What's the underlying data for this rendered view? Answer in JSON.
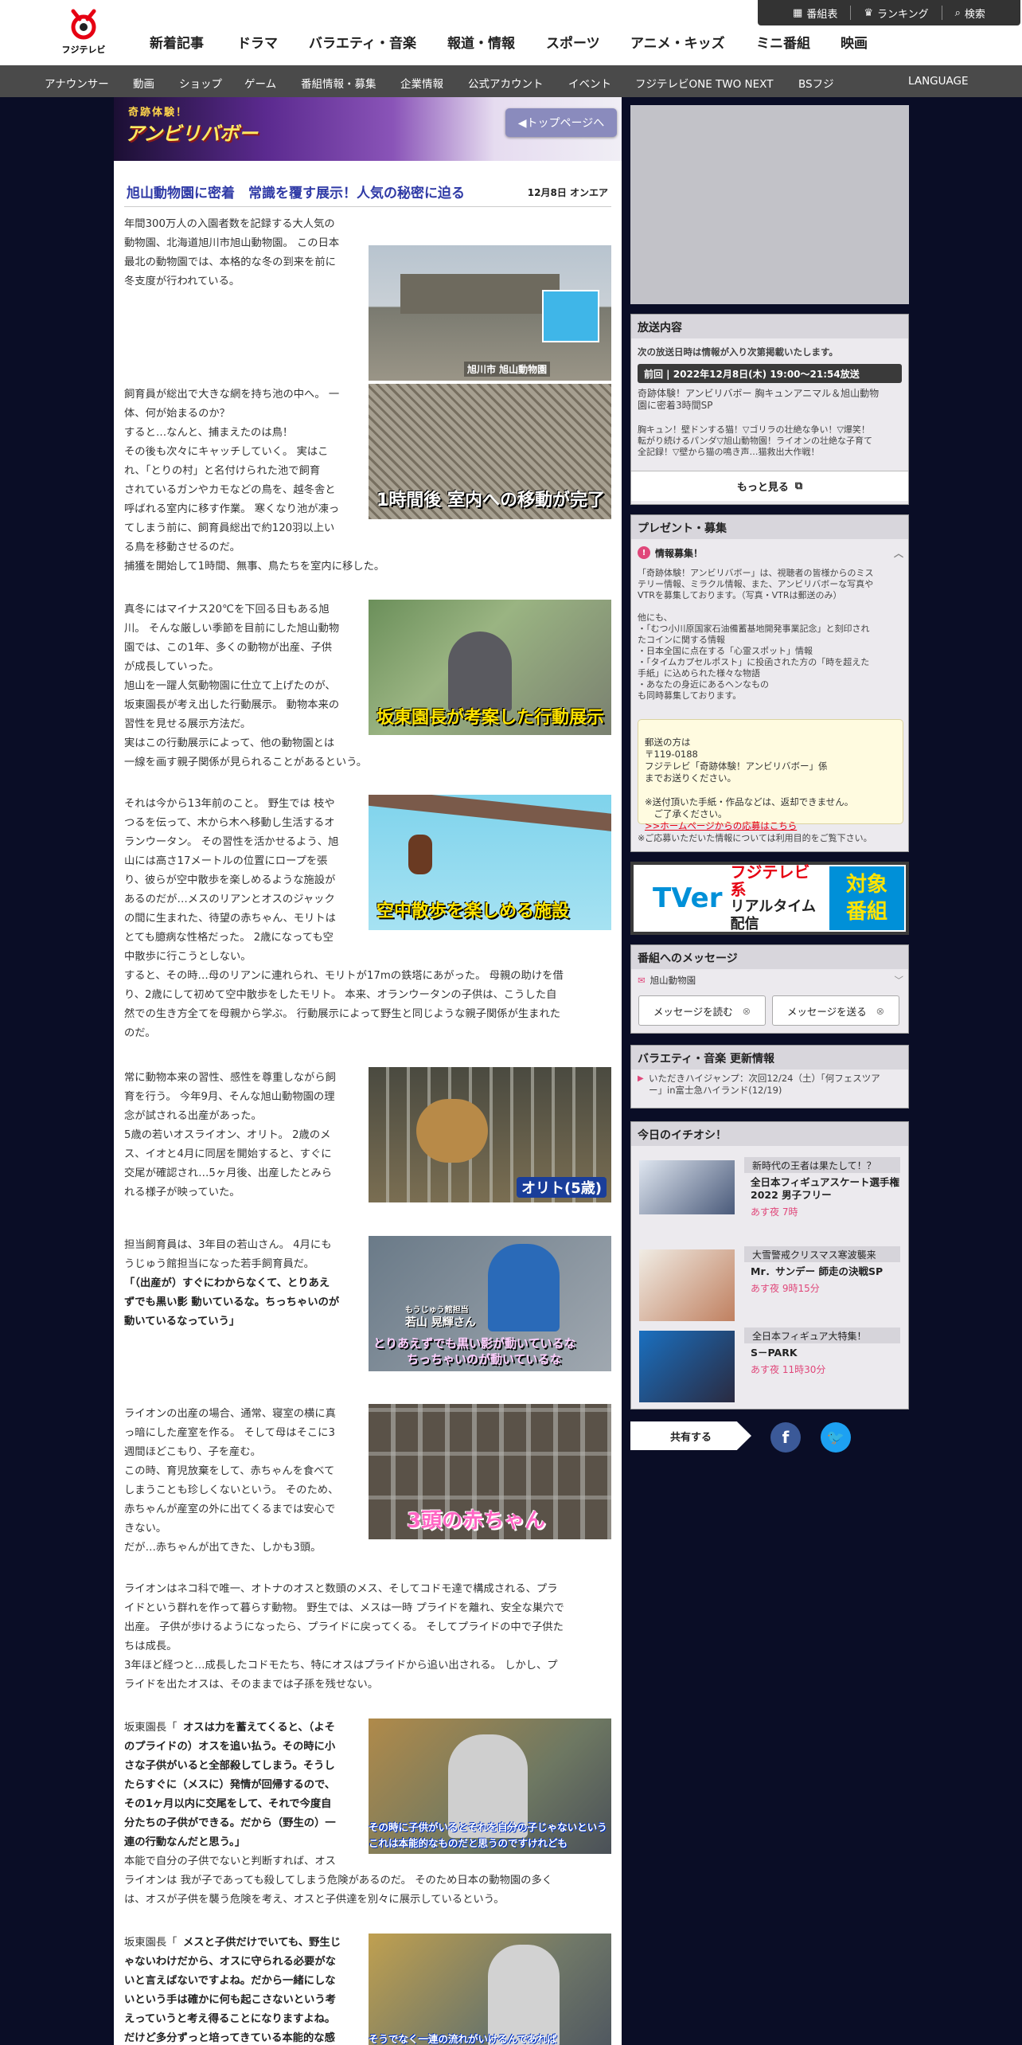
{
  "header": {
    "logo_text": "フジテレビ",
    "nav": [
      "新着記事",
      "ドラマ",
      "バラエティ・音楽",
      "報道・情報",
      "スポーツ",
      "アニメ・キッズ",
      "ミニ番組",
      "映画"
    ],
    "util": {
      "schedule": "番組表",
      "ranking": "ランキング",
      "search": "検索"
    },
    "subnav": [
      "アナウンサー",
      "動画",
      "ショップ",
      "ゲーム",
      "番組情報・募集",
      "企業情報",
      "公式アカウント",
      "イベント",
      "フジテレビONE TWO NEXT",
      "BSフジ",
      "LANGUAGE"
    ]
  },
  "hero": {
    "title_small": "奇跡体験！",
    "title_big": "アンビリバボー",
    "top_button": "◀トップページへ"
  },
  "article": {
    "title": "旭山動物園に密着　常識を覆す展示！人気の秘密に迫る",
    "date": "12月8日 オンエア",
    "paras": [
      "年間300万人の入園者数を記録する大人気の\n動物園、北海道旭川市旭山動物園。 この日本\n最北の動物園では、本格的な冬の到来を前に\n冬支度が行われている。",
      "飼育員が総出で大きな網を持ち池の中へ。 一\n体、何が始まるのか？\nすると…なんと、捕まえたのは鳥！\nその後も次々にキャッチしていく。 実はこ\nれ、「とりの村」と名付けられた池で飼育\nされているガンやカモなどの鳥を、越冬舎と\n呼ばれる室内に移す作業。 寒くなり池が凍っ\nてしまう前に、飼育員総出で約120羽以上い\nる鳥を移動させるのだ。\n捕獲を開始して1時間、無事、鳥たちを室内に移した。",
      "真冬にはマイナス20℃を下回る日もある旭\n川。 そんな厳しい季節を目前にした旭山動物\n園では、この1年、多くの動物が出産、子供\nが成長していった。\n旭山を一躍人気動物園に仕立て上げたのが、\n坂東園長が考え出した行動展示。 動物本来の\n習性を見せる展示方法だ。\n実はこの行動展示によって、他の動物園とは\n一線を画す親子関係が見られることがあるという。",
      "それは今から13年前のこと。 野生では 枝や\nつるを伝って、木から木へ移動し生活するオ\nランウータン。 その習性を活かせるよう、旭\n山には高さ17メートルの位置にロープを張\nり、彼らが空中散歩を楽しめるような施設が\nあるのだが…メスのリアンとオスのジャック\nの間に生まれた、待望の赤ちゃん、モリトは\nとても臆病な性格だった。 2歳になっても空\n中散歩に行こうとしない。\nすると、その時…母のリアンに連れられ、モリトが17mの鉄塔にあがった。 母親の助けを借\nり、2歳にして初めて空中散歩をしたモリト。 本来、オランウータンの子供は、こうした自\n然での生き方全てを母親から学ぶ。 行動展示によって野生と同じような親子関係が生まれた\nのだ。",
      "常に動物本来の習性、感性を尊重しながら飼\n育を行う。 今年9月、そんな旭山動物園の理\n念が試される出産があった。\n5歳の若いオスライオン、オリト。 2歳のメ\nス、イオと4月に同居を開始すると、すぐに\n交尾が確認され…5ヶ月後、出産したとみら\nれる様子が映っていた。",
      "担当飼育員は、3年目の若山さん。 4月にも\nうじゅう館担当になった若手飼育員だ。",
      "「（出産が）すぐにわからなくて、とりあえ\nずでも黒い影 動いているな。ちっちゃいのが\n動いているなっていう」",
      "ライオンの出産の場合、通常、寝室の横に真\nっ暗にした産室を作る。 そして母はそこに3\n週間ほどこもり、子を産む。\nこの時、育児放棄をして、赤ちゃんを食べて\nしまうことも珍しくないという。 そのため、\n赤ちゃんが産室の外に出てくるまでは安心で\nきない。\nだが…赤ちゃんが出てきた、しかも3頭。",
      "ライオンはネコ科で唯一、オトナのオスと数頭のメス、そしてコドモ達で構成される、プラ\nイドという群れを作って暮らす動物。 野生では、メスは一時 プライドを離れ、安全な巣穴で\n出産。 子供が歩けるようになったら、プライドに戻ってくる。 そしてプライドの中で子供た\nちは成長。\n3年ほど経つと…成長したコドモたち、特にオスはプライドから追い出される。 しかし、プ\nライドを出たオスは、そのままでは子孫を残せない。",
      "坂東園長「",
      "オスは力を蓄えてくると、（よそ\nのプライドの）オスを追い払う。その時に小\nさな子供がいると全部殺してしまう。そうし\nたらすぐに（メスに）発情が回帰するので、\nその1ヶ月以内に交尾をして、それで今度自\n分たちの子供ができる。だから（野生の）一\n連の行動なんだと思う。」",
      "本能で自分の子供でないと判断すれば、オス\nライオンは 我が子であっても殺してしまう危険があるのだ。 そのため日本の動物園の多く\nは、オスが子供を襲う危険を考え、オスと子供達を別々に展示しているという。",
      "坂東園長「",
      "メスと子供だけでいても、野生じ\nゃないわけだから、オスに守られる必要がな\nいと言えばないですよね。だから一緒にしな\nいという手は確かに何も起こさないという考\nえっていうと考え得ることになりますよね。\nだけど多分ずっと培ってきている本能的な感"
    ],
    "captions": [
      "旭川市 旭山動物園",
      "1時間後 室内への移動が完了",
      "坂東園長が考案した行動展示",
      "空中散歩を楽しめる施設",
      "オリト(5歳)",
      "もうじゅう館担当",
      "若山 晃輝さん",
      "とりあえずでも黒い影が動いているな",
      "ちっちゃいのが動いているな",
      "3頭の赤ちゃん",
      "その時に子供がいるとそれを自分の子じゃないという",
      "これは本能的なものだと思うのですけれども",
      "そうでなく一連の流れがいけるんであれば"
    ]
  },
  "sidebar": {
    "broadcast": {
      "header": "放送内容",
      "note": "次の放送日時は情報が入り次第掲載いたします。",
      "prev_tag": "前回 | 2022年12月8日(木) 19:00～21:54放送",
      "title": "奇跡体験！アンビリバボー 胸キュンアニマル＆旭山動物\n園に密着3時間SP",
      "desc": "胸キュン！壁ドンする猫！▽ゴリラの壮絶な争い！▽爆笑！\n転がり続けるパンダ▽旭山動物園！ライオンの壮絶な子育て\n全記録！▽壁から猫の鳴き声…猫救出大作戦！",
      "more": "もっと見る"
    },
    "present": {
      "header": "プレゼント・募集",
      "sub": "情報募集！",
      "body": "「奇跡体験！アンビリバボー」は、視聴者の皆様からのミス\nテリー情報、ミラクル情報、また、アンビリバボーな写真や\nVTRを募集しております。（写真・VTRは郵送のみ）\n\n他にも、\n・「むつ小川原国家石油備蓄基地開発事業記念」と刻印され\nたコインに関する情報\n・日本全国に点在する「心霊スポット」情報\n・「タイムカプセルポスト」に投函された方の「時を超えた\n手紙」に込められた様々な物語\n・あなたの身近にあるヘンなもの\nも同時募集しております。",
      "mail": "郵送の方は\n〒119-0188\nフジテレビ「奇跡体験！アンビリバボー」係\nまでお送りください。\n\n※送付頂いた手紙・作品などは、返却できません。\n　ご了承ください。",
      "mail_link": ">>ホームページからの応募はこちら",
      "privacy": "※ご応募いただいた情報については利用目的をご覧下さい。"
    },
    "tver": {
      "brand": "TVer",
      "label1": "フジテレビ系",
      "label2": "リアルタイム配信",
      "badge1": "対象",
      "badge2": "番組"
    },
    "message": {
      "header": "番組へのメッセージ",
      "topic": "旭山動物園",
      "read": "メッセージを読む",
      "send": "メッセージを送る"
    },
    "variety": {
      "header": "バラエティ・音楽 更新情報",
      "item": "いただきハイジャンプ：次回12/24（土）「何フェスツア\nー」in富士急ハイランド(12/19)"
    },
    "picks": {
      "header": "今日のイチオシ！",
      "items": [
        {
          "tag": "新時代の王者は果たして！？",
          "title": "全日本フィギュアスケート選手権\n2022 男子フリー",
          "time": "あす夜 7時"
        },
        {
          "tag": "大雪警戒クリスマス寒波襲来",
          "title": "Mr．サンデー 師走の決戦SP",
          "time": "あす夜 9時15分"
        },
        {
          "tag": "全日本フィギュア大特集！",
          "title": "S－PARK",
          "time": "あす夜 11時30分"
        }
      ]
    },
    "share": "共有する"
  },
  "colors": {
    "accent": "#2f3aa6",
    "navy_bg": "#0a0d26",
    "subnav": "#4a4a4a",
    "tver_blue": "#0090d8",
    "fuji_red": "#e60012"
  }
}
